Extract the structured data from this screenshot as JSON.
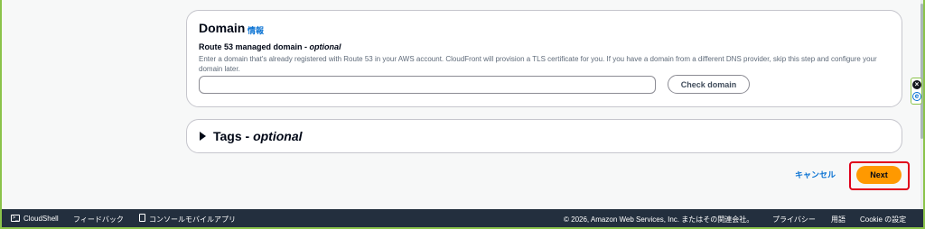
{
  "domain_section": {
    "title": "Domain",
    "info_link": "情報",
    "field_label": "Route 53 managed domain - ",
    "field_label_optional": "optional",
    "description": "Enter a domain that's already registered with Route 53 in your AWS account. CloudFront will provision a TLS certificate for you. If you have a domain from a different DNS provider, skip this step and configure your domain later.",
    "input_value": "",
    "input_placeholder": "",
    "check_button": "Check domain"
  },
  "tags_section": {
    "title": "Tags - ",
    "title_optional": "optional"
  },
  "actions": {
    "cancel": "キャンセル",
    "next": "Next"
  },
  "footer": {
    "cloudshell": "CloudShell",
    "feedback": "フィードバック",
    "console_mobile": "コンソールモバイルアプリ",
    "copyright": "© 2026, Amazon Web Services, Inc. またはその関連会社。",
    "privacy": "プライバシー",
    "terms": "用語",
    "cookie": "Cookie の設定"
  },
  "colors": {
    "accent": "#0972d3",
    "primary_button": "#ff9900",
    "highlight": "#e0001a",
    "footer_bg": "#232f3e"
  }
}
